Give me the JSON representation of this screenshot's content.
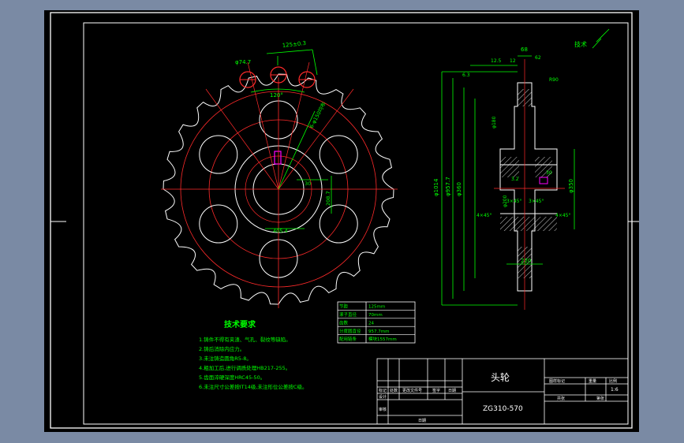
{
  "drawing": {
    "title_zh": "头轮",
    "drawing_no": "ZG310-570",
    "scale": "1:6",
    "stamp": "技术",
    "title_block": {
      "col_labels": [
        "标记",
        "处数",
        "更改文件号",
        "签字",
        "日期"
      ],
      "row_labels": [
        "设计",
        "审核",
        "日期"
      ],
      "right_header": [
        "图样标记",
        "重量",
        "比例"
      ],
      "right_footer": [
        "共张",
        "第张"
      ]
    }
  },
  "dimensions": {
    "d_outer_vertical": "φ1014",
    "d_pitch_vertical": "φ957.7",
    "d_hub": "φ350",
    "d_bore": "φ360",
    "d_hole_top": "φ74.7",
    "d_side1": "φ180",
    "d_side2": "φ200",
    "radius": "R90",
    "angle_dim": "120°",
    "top_pitch": "125±0.3",
    "width_top": "68",
    "width_hub": "220",
    "chamfer_left": "3×45°",
    "chamfer_right": "3×45°",
    "chamfer_b1": "4×45°",
    "chamfer_b2": "4×45°",
    "roughness_a": "6.3",
    "roughness_b": "12.5",
    "roughness_c": "3.2",
    "side_dim_12": "12",
    "side_dim_62": "62",
    "keyway_w": "30",
    "keyway_t": "405.4",
    "hub_len": "208.7",
    "hole_spec": "6-φ150均布"
  },
  "tech_requirements": {
    "heading": "技术要求",
    "items": [
      "1.铸件不得有夹渣、气孔、裂纹等缺陷。",
      "2.铸后消除内应力。",
      "3.未注铸造圆角R5-8。",
      "4.粗加工后,进行调质处理HB217-255。",
      "5.齿面淬硬深度HRC45-50。",
      "6.未注尺寸公差按IT14级,未注形位公差按C级。"
    ]
  },
  "param_table": {
    "rows": [
      {
        "label": "节距",
        "value": "125mm"
      },
      {
        "label": "滚子直径",
        "value": "70mm"
      },
      {
        "label": "齿数",
        "value": "24"
      },
      {
        "label": "分度圆直径",
        "value": "957.7mm"
      },
      {
        "label": "配用链条",
        "value": "模块1557mm"
      }
    ]
  },
  "colors": {
    "background": "#000000",
    "frame": "#ffffff",
    "geometry": "#ffffff",
    "centerline": "#ff2a2a",
    "dimension": "#00ff00",
    "accent": "#ff00ff",
    "text": "#00ff00",
    "page": "#7a8aa4"
  }
}
